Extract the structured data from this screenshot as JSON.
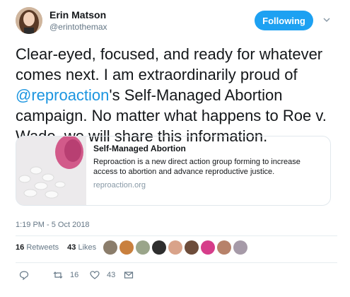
{
  "author": {
    "name": "Erin Matson",
    "handle": "@erintothemax"
  },
  "follow_button": {
    "label": "Following",
    "color": "#1da1f2"
  },
  "tweet": {
    "text_part1": "Clear-eyed, focused, and ready for whatever comes next. I am extraordinarily proud of ",
    "mention": "@reproaction",
    "text_part2": "'s Self-Managed Abortion campaign. No matter what happens to Roe v. Wade, we will share this information."
  },
  "card": {
    "title": "Self-Managed Abortion",
    "description": "Reproaction is a new direct action group forming to increase access to abortion and advance reproductive justice.",
    "domain": "reproaction.org"
  },
  "timestamp": "1:19 PM - 5 Oct 2018",
  "stats": {
    "retweets_count": "16",
    "retweets_label": "Retweets",
    "likes_count": "43",
    "likes_label": "Likes"
  },
  "actions": {
    "reply_count": "",
    "retweet_count": "16",
    "like_count": "43"
  },
  "icons": [
    "chevron-down-icon",
    "reply-icon",
    "retweet-icon",
    "heart-icon",
    "message-icon"
  ],
  "colors": {
    "accent": "#1da1f2",
    "mention": "#1b95e0",
    "muted": "#657786"
  }
}
